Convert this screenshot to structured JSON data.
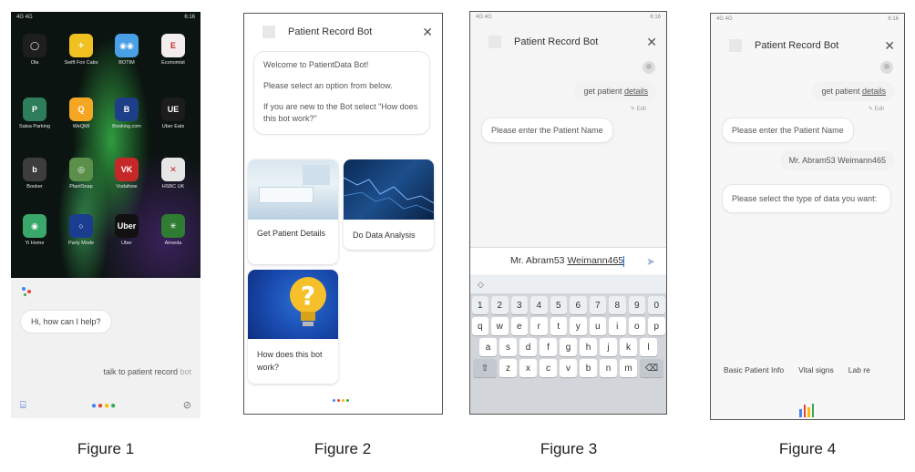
{
  "captions": [
    "Figure 1",
    "Figure 2",
    "Figure 3",
    "Figure 4"
  ],
  "fig1": {
    "status_left": "4G 4G",
    "status_right": "6:16",
    "apps": [
      {
        "label": "Ola",
        "icon": "ola-icon",
        "color": "#1e1e1e",
        "glyph": "◯"
      },
      {
        "label": "Swift Fox Cabs",
        "icon": "fox-icon",
        "color": "#f0c020",
        "glyph": "✈"
      },
      {
        "label": "BOTIM",
        "icon": "botim-icon",
        "color": "#4aa0e6",
        "glyph": "◉◉"
      },
      {
        "label": "Economist",
        "icon": "economist-icon",
        "color": "#f3eded",
        "glyph": "E"
      },
      {
        "label": "Salsa Parking",
        "icon": "parking-icon",
        "color": "#2e7d5b",
        "glyph": "P"
      },
      {
        "label": "WeQMI",
        "icon": "weqmi-icon",
        "color": "#f5a623",
        "glyph": "Q"
      },
      {
        "label": "Booking.com",
        "icon": "booking-icon",
        "color": "#1e3f88",
        "glyph": "B"
      },
      {
        "label": "Uber Eats",
        "icon": "uber-eats-icon",
        "color": "#1c1c1c",
        "glyph": "UE"
      },
      {
        "label": "Booker",
        "icon": "booker-icon",
        "color": "#3d3d3d",
        "glyph": "b"
      },
      {
        "label": "PlantSnap",
        "icon": "plantsnap-icon",
        "color": "#5b8f4a",
        "glyph": "◎"
      },
      {
        "label": "Vodafone",
        "icon": "vodafone-icon",
        "color": "#c62828",
        "glyph": "VK"
      },
      {
        "label": "HSBC UK",
        "icon": "hsbc-icon",
        "color": "#e6e6e6",
        "glyph": "✕"
      },
      {
        "label": "Yi Home",
        "icon": "yihome-icon",
        "color": "#3aa86b",
        "glyph": "◉"
      },
      {
        "label": "Party Mode",
        "icon": "partymode-icon",
        "color": "#1b3d8f",
        "glyph": "○"
      },
      {
        "label": "Uber",
        "icon": "uber-icon",
        "color": "#111111",
        "glyph": "Uber"
      },
      {
        "label": "Airveda",
        "icon": "airveda-icon",
        "color": "#2e7d32",
        "glyph": "✳"
      }
    ],
    "greeting": "Hi, how can I help?",
    "user_query": "talk to patient record",
    "user_query_faded": " bot"
  },
  "fig2": {
    "title": "Patient Record Bot",
    "close": "✕",
    "welcome": [
      "Welcome to PatientData Bot!",
      "Please select an option from below.",
      "If you are new to the Bot select \"How does this bot work?\""
    ],
    "cards": {
      "patient": "Get Patient Details",
      "analysis": "Do Data Analysis",
      "how": "How does this bot work?"
    }
  },
  "fig3": {
    "title": "Patient Record Bot",
    "close": "✕",
    "user_msg_pre": "get patient ",
    "user_msg_link": "details",
    "edit": "✎ Edit",
    "bot_msg": "Please enter the Patient Name",
    "input_pre": "Mr. Abram53 ",
    "input_underlined": "Weimann465",
    "keyboard": {
      "numbers": [
        "1",
        "2",
        "3",
        "4",
        "5",
        "6",
        "7",
        "8",
        "9",
        "0"
      ],
      "row1": [
        "q",
        "w",
        "e",
        "r",
        "t",
        "y",
        "u",
        "i",
        "o",
        "p"
      ],
      "row2": [
        "a",
        "s",
        "d",
        "f",
        "g",
        "h",
        "j",
        "k",
        "l"
      ],
      "row3": [
        "z",
        "x",
        "c",
        "v",
        "b",
        "n",
        "m"
      ]
    }
  },
  "fig4": {
    "title": "Patient Record Bot",
    "close": "✕",
    "user_msg_pre": "get patient ",
    "user_msg_link": "details",
    "edit": "✎ Edit",
    "bot_msg1": "Please enter the Patient Name",
    "user_msg2": "Mr. Abram53 Weimann465",
    "bot_msg2": "Please select the type of data you want:",
    "chips": [
      "Basic Patient Info",
      "Vital signs",
      "Lab re"
    ]
  },
  "colors": {
    "google_blue": "#4285f4",
    "google_red": "#ea4335",
    "google_yellow": "#fbbc05",
    "google_green": "#34a853"
  }
}
